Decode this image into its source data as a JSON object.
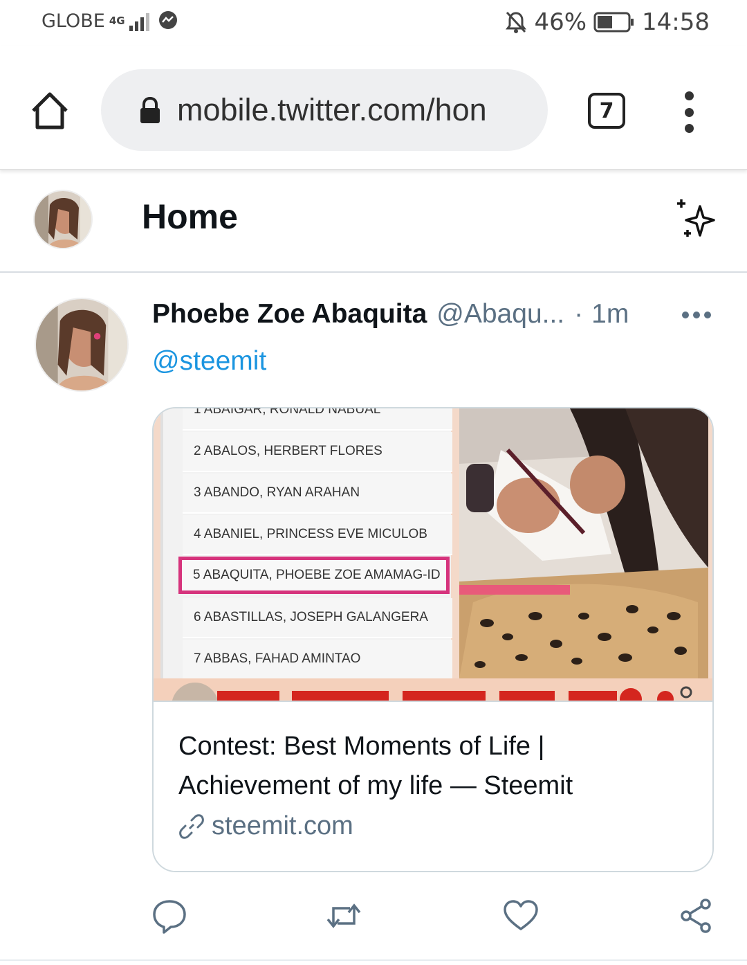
{
  "status_bar": {
    "carrier": "GLOBE",
    "network": "4G",
    "battery": "46%",
    "time": "14:58"
  },
  "browser": {
    "url": "mobile.twitter.com/hon",
    "tab_count": "7"
  },
  "header": {
    "title": "Home"
  },
  "tweet": {
    "author_name": "Phoebe Zoe Abaquita",
    "author_handle": "@Abaqu...",
    "separator": "·",
    "time": "1m",
    "text": "@steemit",
    "card": {
      "list": [
        "1 ABAIGAR, RONALD NABUAL",
        "2 ABALOS, HERBERT FLORES",
        "3 ABANDO, RYAN ARAHAN",
        "4 ABANIEL, PRINCESS EVE MICULOB",
        "5 ABAQUITA, PHOEBE ZOE AMAMAG-ID",
        "6 ABASTILLAS, JOSEPH GALANGERA",
        "7 ABBAS, FAHAD AMINTAO"
      ],
      "title": "Contest: Best Moments of Life | Achievement of my life — Steemit",
      "domain": "steemit.com"
    }
  },
  "colors": {
    "link_blue": "#1b95e0",
    "highlight_pink": "#d6337c",
    "muted_text": "#5b7083"
  },
  "icons": {
    "browser": [
      "home-icon",
      "lock-icon",
      "tabs-icon",
      "more-vert-icon"
    ],
    "header": [
      "sparkle-icon"
    ],
    "actions": [
      "reply-icon",
      "retweet-icon",
      "like-icon",
      "share-icon"
    ]
  }
}
